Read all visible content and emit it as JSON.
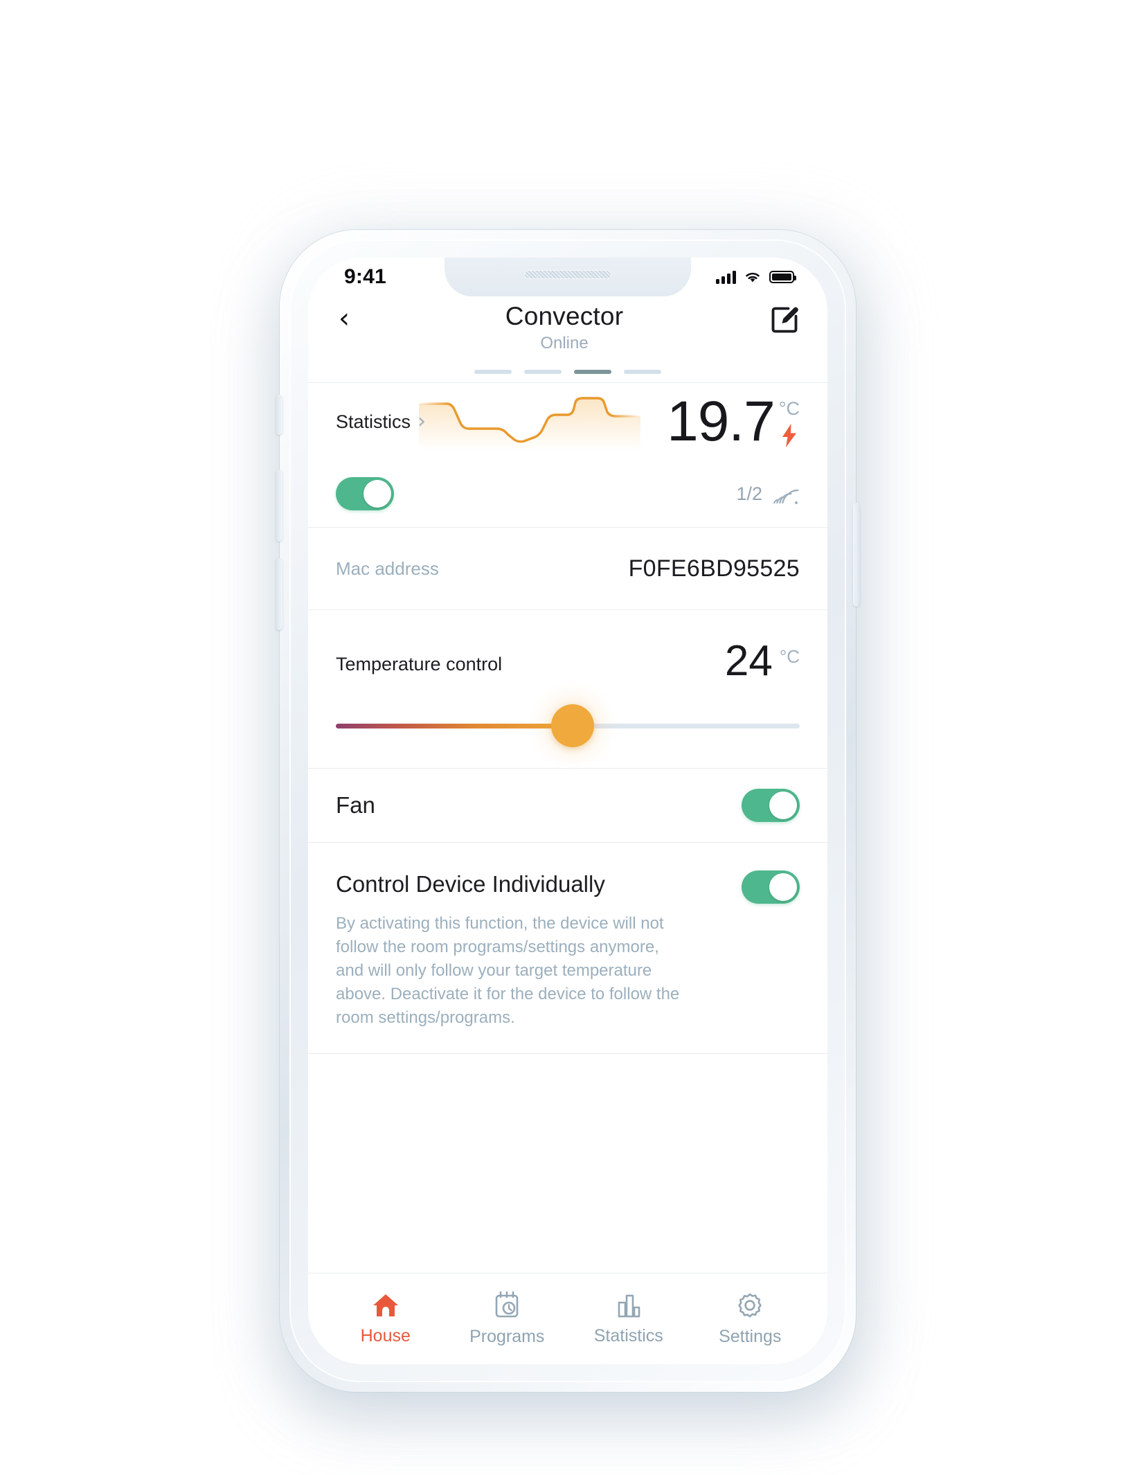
{
  "status_bar": {
    "time": "9:41",
    "icons": [
      "signal-icon",
      "wifi-icon",
      "battery-icon"
    ]
  },
  "header": {
    "back_icon": "chevron-left-icon",
    "title": "Convector",
    "subtitle": "Online",
    "edit_icon": "edit-pencil-icon",
    "pager": {
      "count": 4,
      "active_index": 2
    }
  },
  "stats_card": {
    "statistics_label": "Statistics",
    "chevron_icon": "chevron-right-icon",
    "sparkline_icon": "temperature-sparkline",
    "temperature_value": "19.7",
    "temperature_unit": "°C",
    "bolt_icon": "lightning-bolt-icon",
    "power_toggle": {
      "name": "device-power-toggle",
      "on": true
    },
    "devices_count": "1/2",
    "signal_icon": "wifi-signal-icon"
  },
  "mac_row": {
    "label": "Mac address",
    "value": "F0FE6BD95525"
  },
  "temperature_control": {
    "label": "Temperature control",
    "value": "24",
    "unit": "°C",
    "slider": {
      "name": "temperature-slider",
      "percent": 51,
      "min": 0,
      "max": 100
    }
  },
  "fan": {
    "label": "Fan",
    "toggle": {
      "name": "fan-toggle",
      "on": true
    }
  },
  "control_device": {
    "title": "Control Device Individually",
    "description": "By activating this function, the device will not follow the room programs/settings anymore, and will only follow your target temperature above. Deactivate it for the device to follow the room settings/programs.",
    "toggle": {
      "name": "control-device-individually-toggle",
      "on": true
    }
  },
  "tabbar": {
    "active_index": 0,
    "items": [
      {
        "label": "House",
        "icon": "house-icon"
      },
      {
        "label": "Programs",
        "icon": "calendar-clock-icon"
      },
      {
        "label": "Statistics",
        "icon": "bar-chart-icon"
      },
      {
        "label": "Settings",
        "icon": "gear-icon"
      }
    ]
  },
  "colors": {
    "accent_orange": "#EFA93C",
    "accent_red": "#E8593B",
    "toggle_green": "#4FB78D",
    "muted_gray": "#9CAFBD",
    "text_dark": "#1D1D22"
  }
}
